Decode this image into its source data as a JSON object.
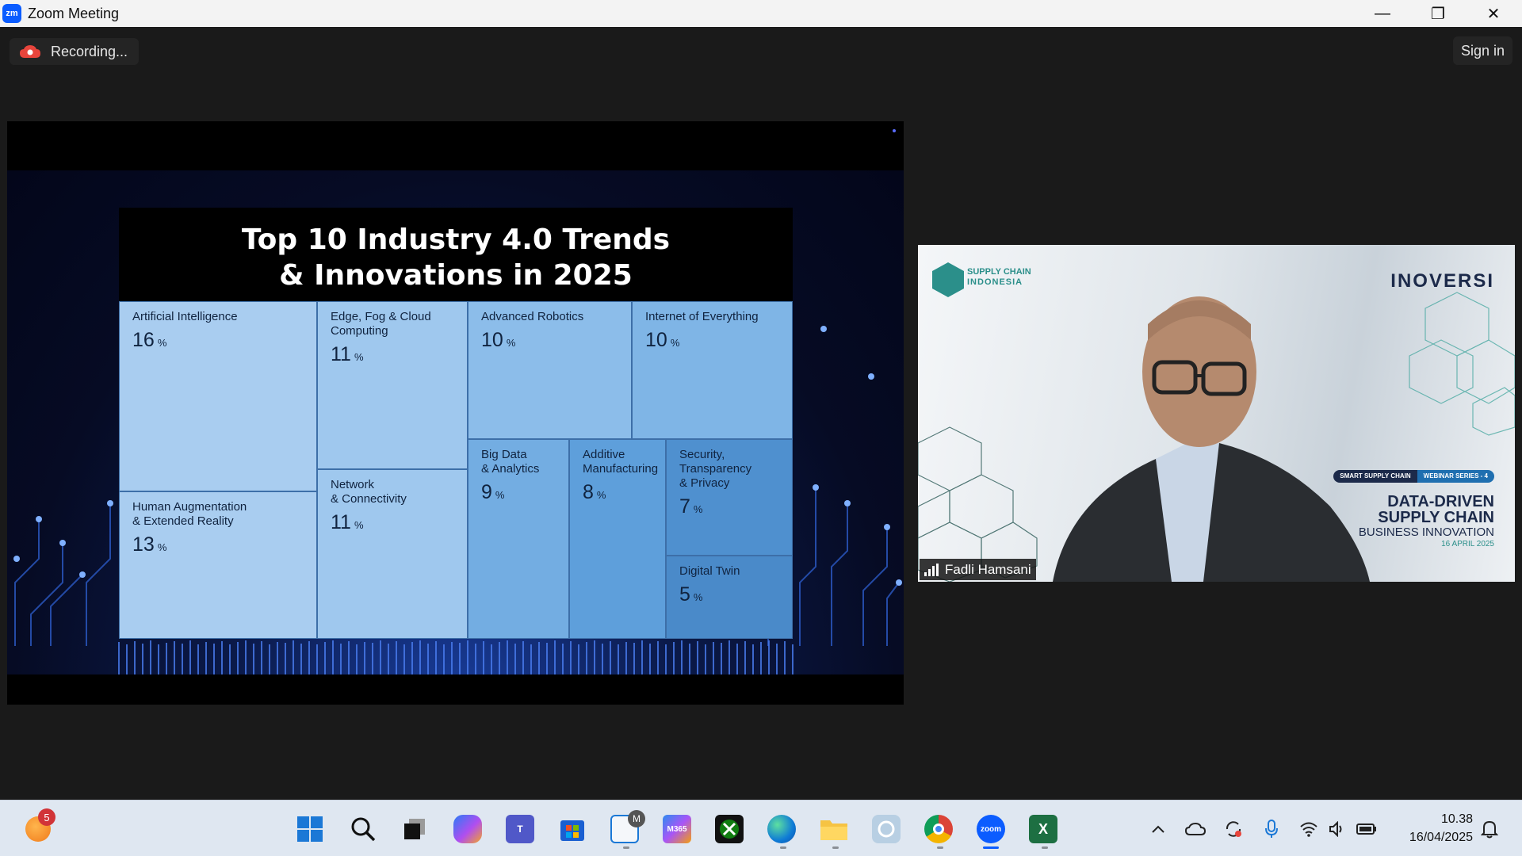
{
  "window": {
    "title": "Zoom Meeting",
    "logo_text": "zm",
    "minimize_glyph": "—",
    "maximize_glyph": "❐",
    "close_glyph": "✕"
  },
  "meeting": {
    "recording_label": "Recording...",
    "sign_in_label": "Sign in"
  },
  "slide": {
    "title_line1": "Top 10 Industry 4.0 Trends",
    "title_line2": "& Innovations in 2025",
    "percent_symbol": "%"
  },
  "chart_data": {
    "type": "treemap",
    "title": "Top 10 Industry 4.0 Trends & Innovations in 2025",
    "unit": "%",
    "items": [
      {
        "label": "Artificial Intelligence",
        "value": 16
      },
      {
        "label": "Human Augmentation\n& Extended Reality",
        "value": 13
      },
      {
        "label": "Edge, Fog & Cloud\nComputing",
        "value": 11
      },
      {
        "label": "Network\n& Connectivity",
        "value": 11
      },
      {
        "label": "Advanced Robotics",
        "value": 10
      },
      {
        "label": "Internet of Everything",
        "value": 10
      },
      {
        "label": "Big Data\n& Analytics",
        "value": 9
      },
      {
        "label": "Additive\nManufacturing",
        "value": 8
      },
      {
        "label": "Security,\nTransparency\n& Privacy",
        "value": 7
      },
      {
        "label": "Digital Twin",
        "value": 5
      }
    ],
    "colors": [
      "#a9cdf0",
      "#a9cdf0",
      "#9fc8ee",
      "#9fc8ee",
      "#8cbdea",
      "#7fb5e6",
      "#73ade2",
      "#5e9fdb",
      "#4f90cf",
      "#4a8ac9"
    ]
  },
  "video": {
    "participant_name": "Fadli Hamsani",
    "brand_left_line1": "SUPPLY CHAIN",
    "brand_left_line2": "INDONESIA",
    "brand_right": "INOVERSI",
    "badge_left": "SMART SUPPLY CHAIN",
    "badge_right": "WEBINAR SERIES - 4",
    "headline_line1": "DATA-DRIVEN",
    "headline_line2": "SUPPLY CHAIN",
    "headline_line3": "BUSINESS INNOVATION",
    "date": "16 APRIL 2025"
  },
  "taskbar": {
    "weather_badge": "5",
    "apps": [
      "Start",
      "Search",
      "Task View",
      "Copilot",
      "Teams",
      "Microsoft Store",
      "Outlook",
      "Microsoft 365",
      "Xbox",
      "Edge",
      "File Explorer",
      "Quick Assist",
      "Chrome",
      "Zoom",
      "Excel"
    ],
    "m365_label": "M365",
    "zoom_label": "zoom",
    "excel_label": "X",
    "outlook_badge": "M",
    "time": "10.38",
    "date": "16/04/2025"
  },
  "colors": {
    "accent": "#0b5cff",
    "recording_red": "#e8453c",
    "taskbar_bg": "#dfe7f1"
  }
}
